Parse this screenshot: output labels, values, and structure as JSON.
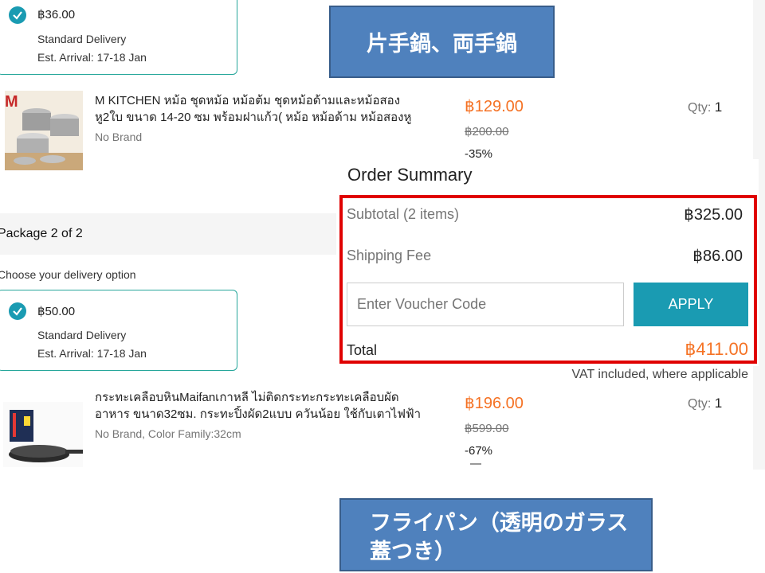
{
  "package1": {
    "delivery": {
      "price": "฿36.00",
      "type": "Standard Delivery",
      "eta": "Est. Arrival: 17-18 Jan"
    },
    "item": {
      "title_line1": "M KITCHEN หม้อ ชุดหม้อ หม้อต้ม ชุดหม้อด้ามและหม้อสอง",
      "title_line2": "หู2ใบ ขนาด 14-20 ซม พร้อมฝาแก้ว( หม้อ หม้อด้าม หม้อสองหู",
      "brand": "No Brand",
      "price": "฿129.00",
      "original_price": "฿200.00",
      "discount": "-35%",
      "qty_label": "Qty:",
      "qty_value": "1"
    }
  },
  "package2": {
    "header": "Package 2 of 2",
    "choose_label": "Choose your delivery option",
    "delivery": {
      "price": "฿50.00",
      "type": "Standard Delivery",
      "eta": "Est. Arrival: 17-18 Jan"
    },
    "item": {
      "title_line1": "กระทะเคลือบหินMaifanเกาหลี ไม่ติดกระทะกระทะเคลือบผัด",
      "title_line2": "อาหาร ขนาด32ซม. กระทะปิ้งผัด2แบบ ควันน้อย ใช้กับเตาไฟฟ้า",
      "brand": "No Brand, Color Family:32cm",
      "price": "฿196.00",
      "original_price": "฿599.00",
      "discount": "-67%",
      "qty_label": "Qty:",
      "qty_value": "1"
    }
  },
  "summary": {
    "title": "Order Summary",
    "subtotal_label": "Subtotal (2 items)",
    "subtotal_value": "฿325.00",
    "shipping_label": "Shipping Fee",
    "shipping_value": "฿86.00",
    "voucher_placeholder": "Enter Voucher Code",
    "apply_label": "APPLY",
    "total_label": "Total",
    "total_value": "฿411.00",
    "vat_note": "VAT included, where applicable"
  },
  "annotations": {
    "pots_label": "片手鍋、両手鍋",
    "pan_label_line1": "フライパン（透明のガラス",
    "pan_label_line2": "蓋つき）"
  },
  "colors": {
    "accent_teal": "#1a9bb2",
    "orange_price": "#f57224",
    "highlight_red": "#e00000",
    "callout_blue": "#4f81bd"
  },
  "icons": [
    "check-icon",
    "pot-set-image",
    "frying-pan-image"
  ]
}
